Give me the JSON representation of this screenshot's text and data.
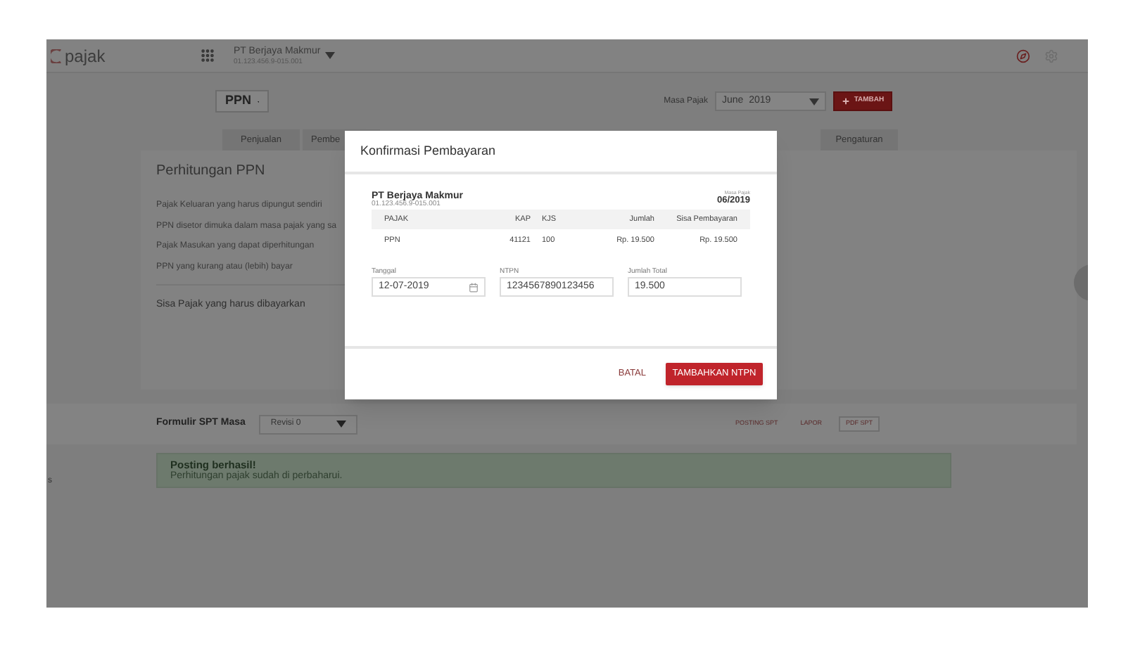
{
  "header": {
    "logo": "pajak",
    "company": "PT Berjaya Makmur",
    "npwp": "01.123.456.9-015.001"
  },
  "toolbar": {
    "tax_type": "PPN",
    "period_label": "Masa Pajak",
    "period_value": "June  2019",
    "add_button": "TAMBAH"
  },
  "tabs": [
    {
      "label": "Penjualan"
    },
    {
      "label": "Pembe"
    },
    {
      "label": "Pengaturan"
    }
  ],
  "calculation": {
    "title": "Perhitungan PPN",
    "rows": [
      "Pajak Keluaran yang harus dipungut sendiri",
      "PPN disetor dimuka dalam masa pajak yang sa",
      "Pajak Masukan yang dapat diperhitungan",
      "PPN yang kurang atau (lebih) bayar"
    ],
    "total_label": "Sisa Pajak yang harus dibayarkan"
  },
  "form": {
    "label": "Formulir SPT Masa",
    "revision": "Revisi 0",
    "actions": [
      {
        "label": "POSTING SPT",
        "kind": "text"
      },
      {
        "label": "LAPOR",
        "kind": "text"
      },
      {
        "label": "PDF SPT",
        "kind": "outlined"
      }
    ]
  },
  "alert": {
    "title": "Posting berhasil!",
    "message": "Perhitungan pajak sudah di perbaharui."
  },
  "side_fragment": "s",
  "modal": {
    "title": "Konfirmasi Pembayaran",
    "company": "PT Berjaya Makmur",
    "npwp": "01.123.456.9-015.001",
    "period_label": "Masa Pajak",
    "period": "06/2019",
    "columns": [
      "PAJAK",
      "KAP",
      "KJS",
      "Jumlah",
      "Sisa Pembayaran"
    ],
    "rows": [
      [
        "PPN",
        "41121",
        "100",
        "Rp. 19.500",
        "Rp. 19.500"
      ]
    ],
    "fields": [
      {
        "label": "Tanggal",
        "value": "12-07-2019",
        "kind": "date"
      },
      {
        "label": "NTPN",
        "value": "1234567890123456",
        "kind": "text"
      },
      {
        "label": "Jumlah Total",
        "value": "19.500",
        "kind": "text"
      }
    ],
    "cancel": "BATAL",
    "confirm": "TAMBAHKAN NTPN"
  }
}
